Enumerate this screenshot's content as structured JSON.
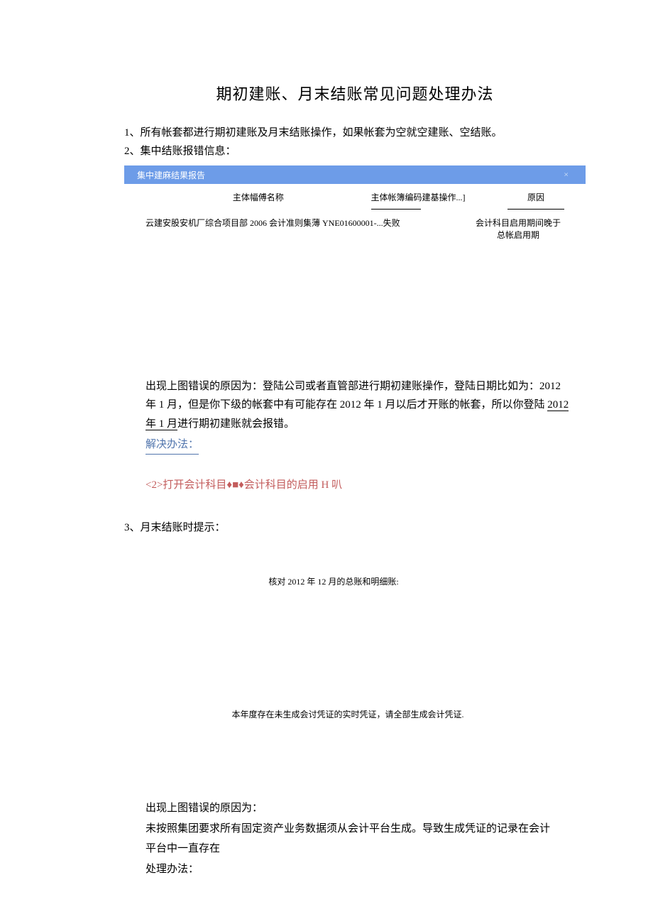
{
  "title": "期初建账、月末结账常见问题处理办法",
  "item1": "1、所有帐套都进行期初建账及月末结账操作，如果帐套为空就空建账、空结账。",
  "item2": "2、集中结账报错信息：",
  "dialog": {
    "header": "集中建麻结果报告",
    "close": "×",
    "columns": {
      "col1": "主体幅傅名称",
      "col2_prefix": "主体帐簿编码建基操作...]",
      "col3_prefix": "原因"
    },
    "row": {
      "name": "云建安股安机厂综合项目部 2006 会计准则集薄 YNE01600001-...失败",
      "reason": "会计科目启用期间晚于总帐启用期"
    }
  },
  "explanation": {
    "line1_a": "出现上图错误的原因为：登陆公司或者直管部进行期初建账操作，登陆日期比如为：2012",
    "line2_a": "年 1 月，但是你下级的帐套中有可能存在 2012 年 1 月以后才开账的帐套，所以你登陆 ",
    "line2_b": "2012",
    "line3_a": "年 1 月",
    "line3_b": "进行期初建账就会报错。"
  },
  "solution_label": "解决办法：",
  "step2": "<2>打开会计科目♦■♦会计科目的启用 H 叭",
  "item3": "3、月末结账时提示：",
  "check_text": "核对 2012 年 12 月的总账和明细账:",
  "warning_text": "本年度存在未生成会讨凭证的实时凭证，请全部生成会计凭证.",
  "reason2": {
    "line1": "出现上图错误的原因为：",
    "line2": "未按照集团要求所有固定资产业务数据须从会计平台生成。导致生成凭证的记录在会计",
    "line3": "平台中一直存在",
    "line4": "处理办法："
  }
}
